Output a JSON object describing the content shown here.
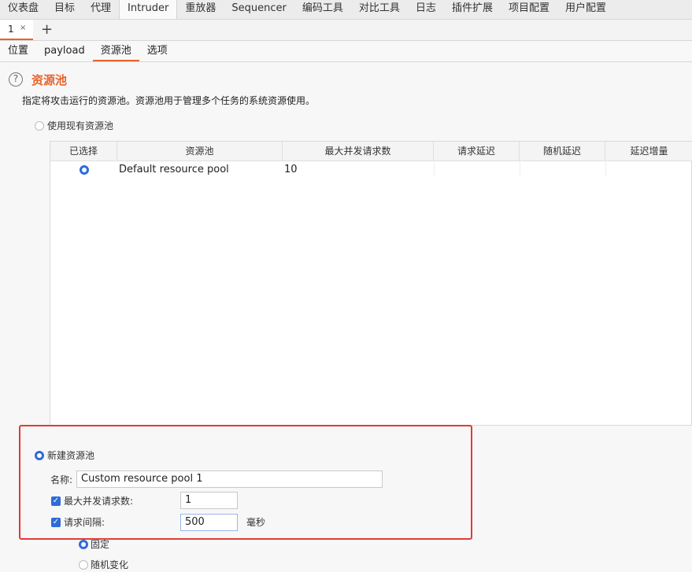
{
  "top_nav": [
    "仪表盘",
    "目标",
    "代理",
    "Intruder",
    "重放器",
    "Sequencer",
    "编码工具",
    "对比工具",
    "日志",
    "插件扩展",
    "项目配置",
    "用户配置"
  ],
  "sub_tab": {
    "label": "1",
    "close": "×",
    "add": "+"
  },
  "config_tabs": [
    "位置",
    "payload",
    "资源池",
    "选项"
  ],
  "section": {
    "title": "资源池",
    "description": "指定将攻击运行的资源池。资源池用于管理多个任务的系统资源使用。"
  },
  "use_existing": {
    "label": "使用现有资源池",
    "selected": false
  },
  "table": {
    "headers": [
      "已选择",
      "资源池",
      "最大并发请求数",
      "请求延迟",
      "随机延迟",
      "延迟增量"
    ],
    "rows": [
      {
        "selected": true,
        "name": "Default resource pool",
        "max_concurrent": "10",
        "request_delay": "",
        "random_delay": "",
        "delay_increment": ""
      }
    ]
  },
  "new_pool": {
    "label": "新建资源池",
    "selected": true,
    "name_label": "名称:",
    "name_value": "Custom resource pool 1",
    "max_concurrent_label": "最大并发请求数:",
    "max_concurrent_checked": true,
    "max_concurrent_value": "1",
    "delay_label": "请求间隔:",
    "delay_checked": true,
    "delay_value": "500",
    "delay_unit": "毫秒",
    "fixed_label": "固定",
    "fixed_selected": true,
    "random_label": "随机变化",
    "random_selected": false
  },
  "colors": {
    "accent": "#e8632c",
    "radio_blue": "#2f6bd8",
    "highlight_border": "#e23a36"
  }
}
